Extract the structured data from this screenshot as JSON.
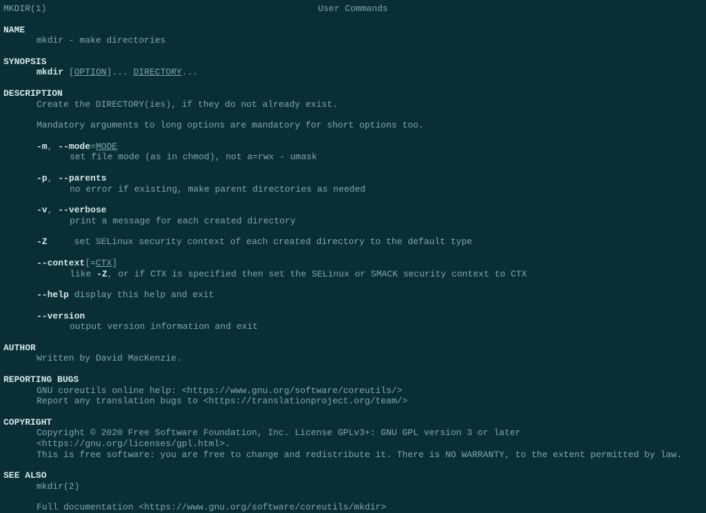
{
  "header": {
    "left": "MKDIR(1)",
    "center": "User Commands"
  },
  "name": {
    "heading": "NAME",
    "text": "mkdir - make directories"
  },
  "synopsis": {
    "heading": "SYNOPSIS",
    "cmd": "mkdir",
    "option": "OPTION",
    "post_option": "... ",
    "directory": "DIRECTORY",
    "post_directory": "..."
  },
  "description": {
    "heading": "DESCRIPTION",
    "p1": "Create the DIRECTORY(ies), if they do not already exist.",
    "p2": "Mandatory arguments to long options are mandatory for short options too."
  },
  "options": {
    "mode": {
      "short": "-m",
      "sep": ", ",
      "long": "--mode",
      "eq": "=",
      "arg": "MODE",
      "desc": "set file mode (as in chmod), not a=rwx - umask"
    },
    "parents": {
      "short": "-p",
      "sep": ", ",
      "long": "--parents",
      "desc": "no error if existing, make parent directories as needed"
    },
    "verbose": {
      "short": "-v",
      "sep": ", ",
      "long": "--verbose",
      "desc": "print a message for each created directory"
    },
    "z": {
      "flag": "-Z",
      "spacer": "     ",
      "desc": "set SELinux security context of each created directory to the default type"
    },
    "context": {
      "flag": "--context",
      "lb": "[=",
      "arg": "CTX",
      "rb": "]",
      "desc_pre": "like ",
      "desc_bold": "-Z",
      "desc_post": ", or if CTX is specified then set the SELinux or SMACK security context to CTX"
    },
    "help": {
      "flag": "--help",
      "desc": " display this help and exit"
    },
    "version": {
      "flag": "--version",
      "desc": "output version information and exit"
    }
  },
  "author": {
    "heading": "AUTHOR",
    "text": "Written by David MacKenzie."
  },
  "bugs": {
    "heading": "REPORTING BUGS",
    "l1": "GNU coreutils online help: <https://www.gnu.org/software/coreutils/>",
    "l2": "Report any translation bugs to <https://translationproject.org/team/>"
  },
  "copyright": {
    "heading": "COPYRIGHT",
    "l1": "Copyright © 2020 Free Software Foundation, Inc.  License GPLv3+: GNU GPL version 3 or later <https://gnu.org/licenses/gpl.html>.",
    "l2": "This is free software: you are free to change and redistribute it.  There is NO WARRANTY, to the extent permitted by law."
  },
  "seealso": {
    "heading": "SEE ALSO",
    "l1": "mkdir(2)",
    "l2": "Full documentation <https://www.gnu.org/software/coreutils/mkdir>"
  }
}
